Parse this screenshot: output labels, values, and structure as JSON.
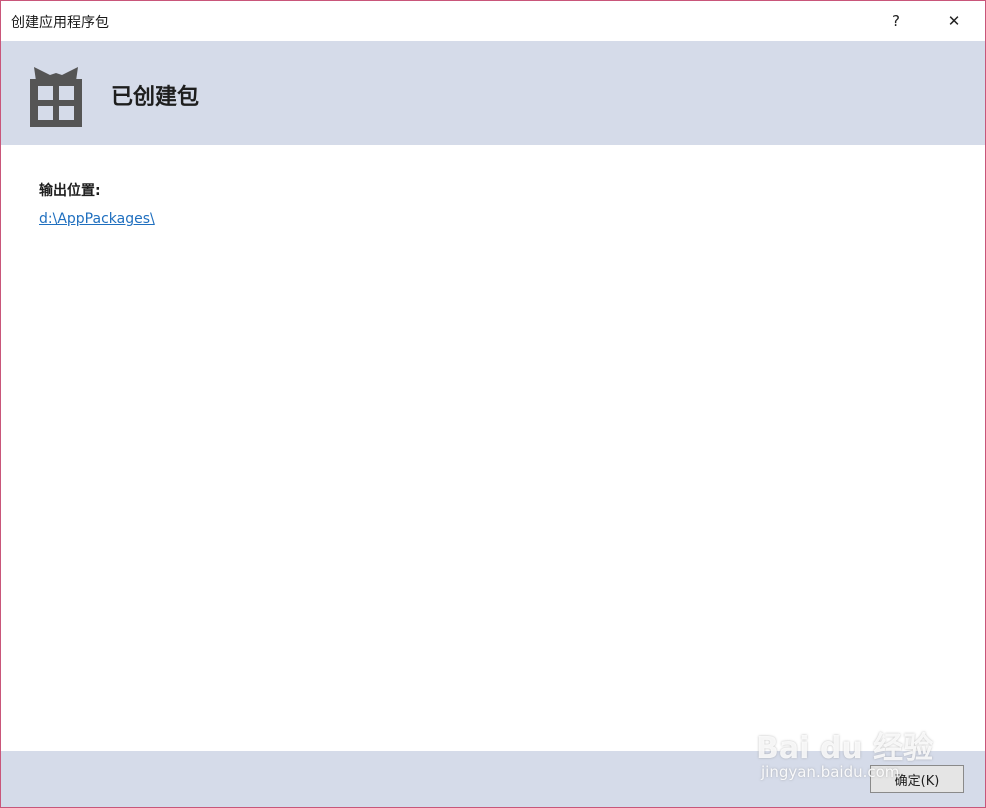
{
  "window": {
    "title": "创建应用程序包",
    "help_glyph": "?",
    "close_glyph": "✕"
  },
  "header": {
    "icon": "gift-package-icon",
    "title": "已创建包"
  },
  "content": {
    "output_label": "输出位置:",
    "output_path": "d:\\AppPackages\\"
  },
  "footer": {
    "ok_label": "确定(K)"
  },
  "watermark": {
    "logo": "Bai du 经验",
    "url": "jingyan.baidu.com"
  },
  "colors": {
    "header_band": "#d5dbe9",
    "link": "#1f6fbf",
    "icon_gray": "#555555",
    "window_border": "#c9567a"
  }
}
